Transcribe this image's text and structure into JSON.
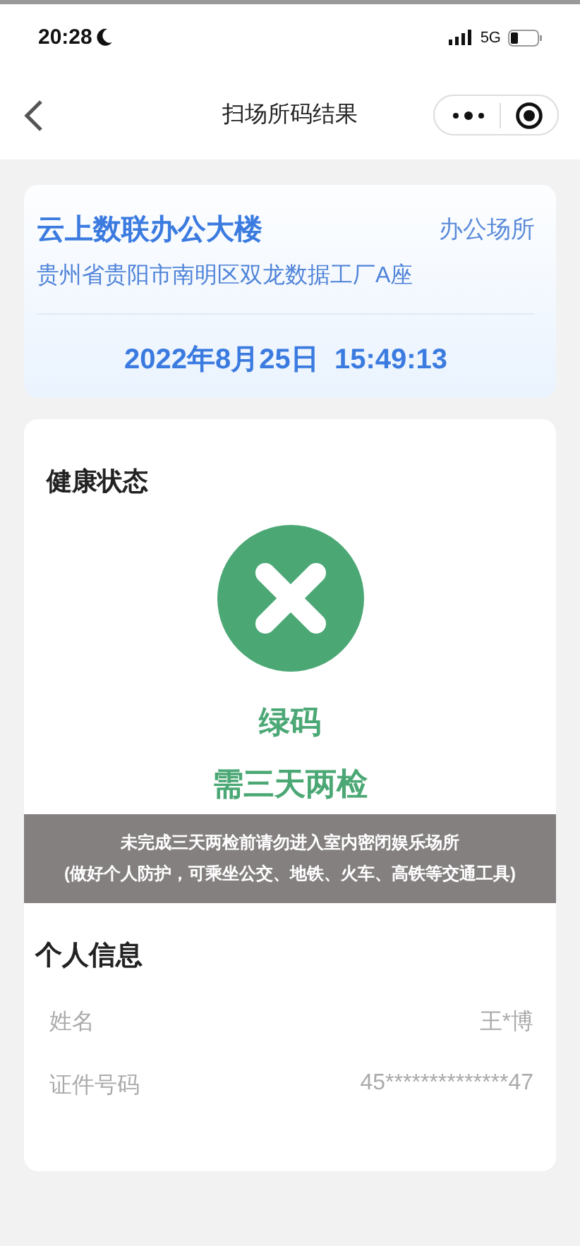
{
  "status_bar": {
    "time": "20:28",
    "network": "5G"
  },
  "nav": {
    "title": "扫场所码结果"
  },
  "venue": {
    "name": "云上数联办公大楼",
    "type": "办公场所",
    "address": "贵州省贵阳市南明区双龙数据工厂A座",
    "datetime": "2022年8月25日  15:49:13"
  },
  "health": {
    "title": "健康状态",
    "code": "绿码",
    "requirement": "需三天两检",
    "notice": [
      "未完成三天两检前请勿进入室内密闭娱乐场所",
      "(做好个人防护，可乘坐公交、地铁、火车、高铁等交通工具)"
    ]
  },
  "personal": {
    "title": "个人信息",
    "rows": [
      {
        "label": "姓名",
        "value": "王*博"
      },
      {
        "label": "证件号码",
        "value": "45**************47"
      }
    ]
  }
}
